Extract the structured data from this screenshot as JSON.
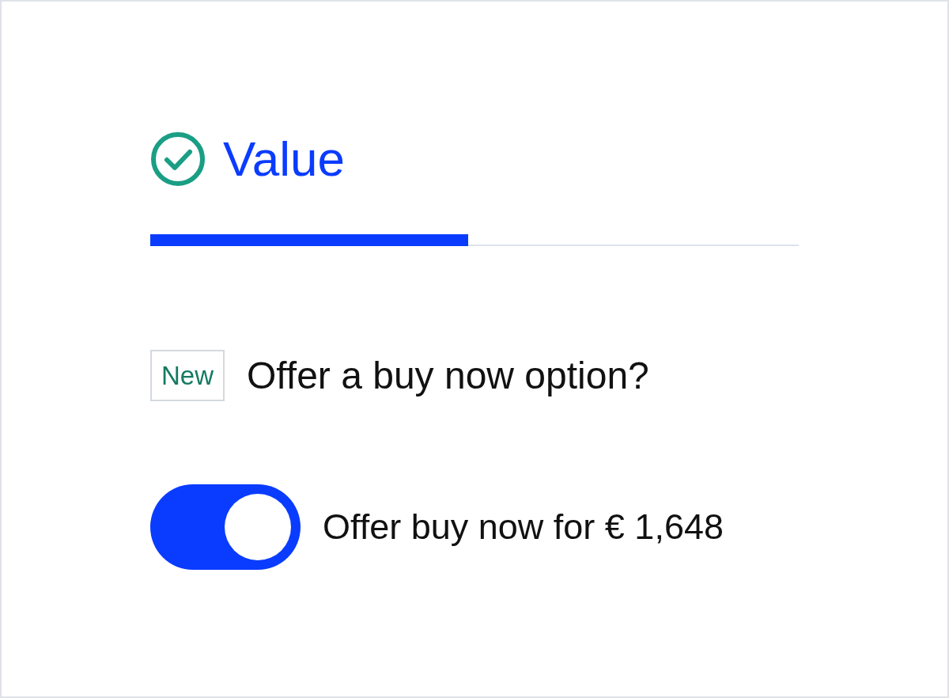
{
  "section": {
    "title": "Value",
    "completed": true
  },
  "progress": {
    "level": 0.49
  },
  "question": {
    "badge": "New",
    "text": "Offer a buy now option?"
  },
  "toggle": {
    "on": true,
    "label": "Offer buy now for € 1,648"
  }
}
